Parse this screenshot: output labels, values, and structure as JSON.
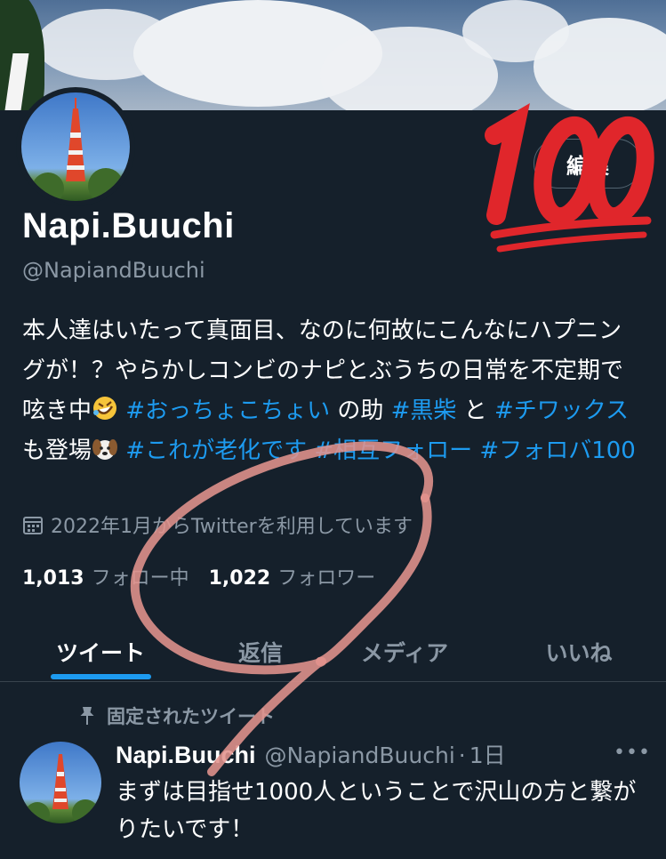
{
  "profile": {
    "display_name": "Napi.Buuchi",
    "handle": "@NapiandBuuchi",
    "edit_label": "編集",
    "bio": {
      "line_text_1": "本人達はいたって真面目、なのに何故にこんなにハプニングが！？やらかしコンビのナピとぶうちの日常を不定期で呟き中",
      "tag_1": "#おっちょこちょい",
      "text_2": " の助 ",
      "tag_2": "#黒柴",
      "text_3": " と ",
      "tag_3": "#チワックス",
      "text_4": " も登場",
      "tag_4": "#これが老化です",
      "tag_5": "#相互フォロー",
      "tag_6": "#フォロバ100"
    },
    "joined": "2022年1月からTwitterを利用しています",
    "following_count": "1,013",
    "following_label": "フォロー中",
    "followers_count": "1,022",
    "followers_label": "フォロワー"
  },
  "tabs": [
    {
      "label": "ツイート",
      "active": true
    },
    {
      "label": "返信",
      "active": false
    },
    {
      "label": "メディア",
      "active": false
    },
    {
      "label": "いいね",
      "active": false
    }
  ],
  "pinned_tweet": {
    "pinned_label": "固定されたツイート",
    "name": "Napi.Buuchi",
    "handle": "@NapiandBuuchi",
    "separator": "·",
    "time": "1日",
    "text": "まずは目指せ1000人ということで沢山の方と繋がりたいです！",
    "more": "•••"
  },
  "colors": {
    "background": "#15202b",
    "link": "#1d9bf0",
    "secondary_text": "#8b98a5",
    "emoji_100": "#e0262b",
    "annotation_circle": "#e3938d"
  },
  "icons": [
    "calendar-icon",
    "pin-icon",
    "more-icon",
    "emoji-100",
    "emoji-rofl",
    "emoji-dog"
  ]
}
